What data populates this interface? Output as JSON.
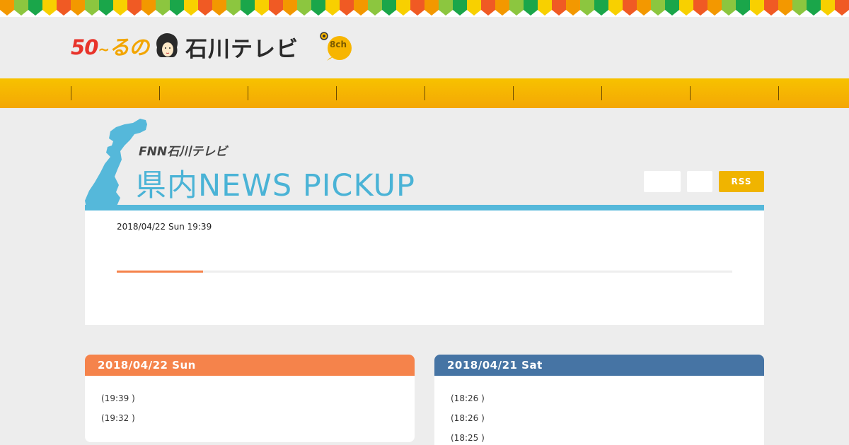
{
  "header": {
    "logo_anniv_5": "5",
    "logo_anniv_0": "0",
    "logo_anniv_tilde": "~",
    "logo_anniv_kana": "るの",
    "logo_station": "石川テレビ",
    "logo_channel": "8ch",
    "banner_colors": [
      "#f39800",
      "#8cc63f",
      "#1aa64a",
      "#f8d000",
      "#f05a24"
    ]
  },
  "nav": {
    "color": "#f7b900",
    "separator_count": 9
  },
  "title_block": {
    "fnn_logo": "FNN石川テレビ",
    "title": "県内NEWS  PICKUP",
    "accent": "#55b8da",
    "rss_label": "RSS"
  },
  "news": {
    "date": "2018/04/22 Sun 19:39",
    "progress": 0.14
  },
  "days": [
    {
      "date": "2018/04/22 Sun",
      "color": "#f5834b",
      "items": [
        "(19:39 )",
        "(19:32 )"
      ]
    },
    {
      "date": "2018/04/21 Sat",
      "color": "#4674a4",
      "items": [
        "(18:26 )",
        "(18:26 )",
        "(18:25 )"
      ]
    }
  ]
}
